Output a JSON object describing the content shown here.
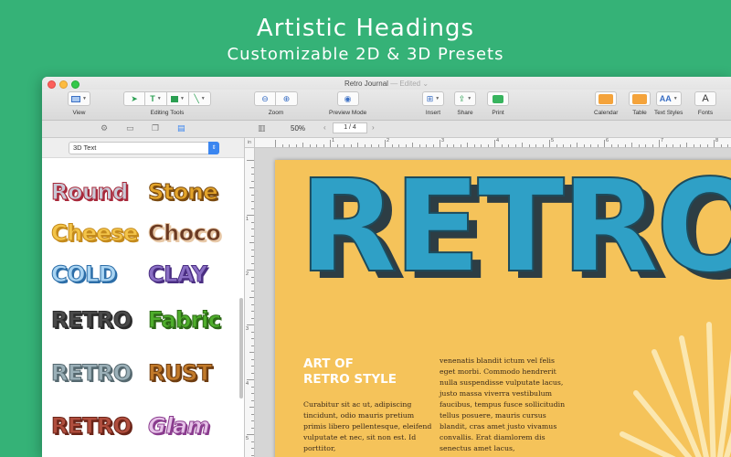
{
  "hero": {
    "title": "Artistic Headings",
    "subtitle": "Customizable 2D & 3D Presets"
  },
  "window": {
    "title": "Retro Journal",
    "edited": "— Edited ⌄"
  },
  "toolbar": {
    "view": "View",
    "editing_tools": "Editing Tools",
    "zoom": "Zoom",
    "preview_mode": "Preview Mode",
    "insert": "Insert",
    "share": "Share",
    "print": "Print",
    "calendar": "Calendar",
    "table": "Table",
    "text_styles": "Text Styles",
    "fonts": "Fonts",
    "text_icon_glyph": "T",
    "textstyles_glyph": "AA",
    "fonts_glyph": "A"
  },
  "subbar": {
    "zoom_value": "50%",
    "page_indicator": "1 / 4"
  },
  "sidebar": {
    "select_value": "3D Text",
    "presets": [
      {
        "label": "Round",
        "color": "#c9c9d6",
        "stroke": "#a8283a"
      },
      {
        "label": "Stone",
        "color": "#e3a42a",
        "stroke": "#7a4a10"
      },
      {
        "label": "Cheese",
        "color": "#f3c449",
        "stroke": "#c48a1c"
      },
      {
        "label": "Choco",
        "color": "#6b3a22",
        "stroke": "#e8c9a8"
      },
      {
        "label": "COLD",
        "color": "#a9d4f2",
        "stroke": "#2d6ea8"
      },
      {
        "label": "CLAY",
        "color": "#8a6fc4",
        "stroke": "#4a2e82"
      },
      {
        "label": "RETRO",
        "color": "#4a4a4a",
        "stroke": "#2b2b2b"
      },
      {
        "label": "Fabric",
        "color": "#4fae2c",
        "stroke": "#2d6a16"
      },
      {
        "label": "RETRO",
        "color": "#9bb0b8",
        "stroke": "#55686f"
      },
      {
        "label": "RUST",
        "color": "#c27a2a",
        "stroke": "#6e3c10"
      },
      {
        "label": "RETRO",
        "color": "#b04e3e",
        "stroke": "#6a2418"
      },
      {
        "label": "Glam",
        "color": "#e6c2e8",
        "stroke": "#8a3c8e"
      }
    ]
  },
  "ruler": {
    "unit": "in",
    "numbers": [
      "1",
      "2",
      "3",
      "4",
      "5",
      "6",
      "7",
      "8"
    ]
  },
  "page": {
    "heading": "RETRO",
    "subheading_line1": "ART OF",
    "subheading_line2": "RETRO STYLE",
    "col1": "Curabitur sit ac ut, adipiscing tincidunt, odio mauris pretium primis libero pellentesque, eleifend vulputate et nec, sit non est. Id porttitor,",
    "col2": "venenatis blandit ictum vel felis eget morbi. Commodo hendrerit nulla suspendisse vulputate lacus, justo massa viverra vestibulum faucibus, tempus fusce sollicitudin tellus posuere, mauris cursus blandit, cras amet justo vivamus convallis. Erat diamlorem dis senectus amet lacus,"
  },
  "colors": {
    "background": "#35b277",
    "page": "#f5c35a",
    "retro_blue": "#2fa0c6",
    "accent_blue": "#3b86f0"
  }
}
